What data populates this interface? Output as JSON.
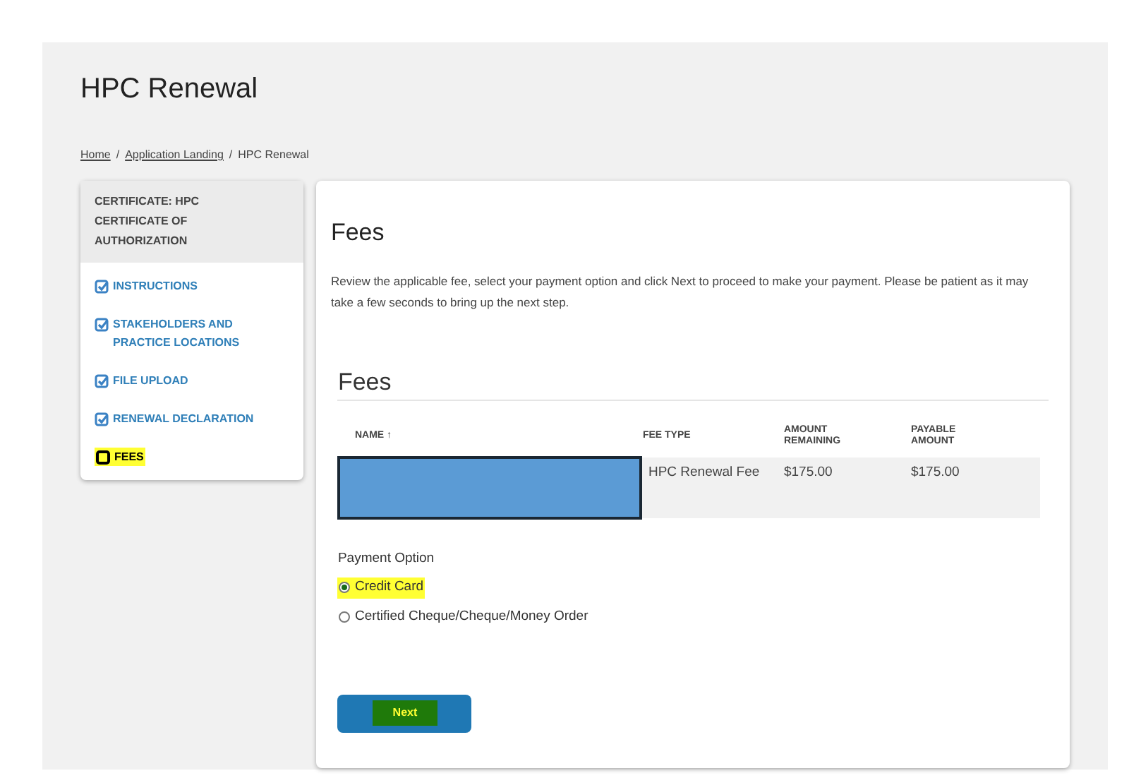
{
  "page_title": "HPC Renewal",
  "breadcrumb": [
    {
      "label": "Home",
      "link": true
    },
    {
      "label": "Application Landing",
      "link": true
    },
    {
      "label": "HPC Renewal",
      "link": false
    }
  ],
  "breadcrumb_separator": "/",
  "sidebar": {
    "header": "CERTIFICATE: HPC CERTIFICATE OF AUTHORIZATION",
    "items": [
      {
        "label": "INSTRUCTIONS",
        "completed": true,
        "highlighted": false
      },
      {
        "label": "STAKEHOLDERS AND PRACTICE LOCATIONS",
        "completed": true,
        "highlighted": false
      },
      {
        "label": "FILE UPLOAD",
        "completed": true,
        "highlighted": false
      },
      {
        "label": "RENEWAL DECLARATION",
        "completed": true,
        "highlighted": false
      },
      {
        "label": "FEES",
        "completed": false,
        "highlighted": true
      }
    ]
  },
  "main": {
    "title": "Fees",
    "description": "Review the applicable fee, select your payment option and click Next to proceed to make your payment. Please be patient as it may take a few seconds to bring up the next step.",
    "section_title": "Fees",
    "table": {
      "sort_indicator": "↑",
      "columns": [
        {
          "label": "NAME",
          "sorted": true
        },
        {
          "label": "FEE TYPE",
          "sorted": false
        },
        {
          "label": "AMOUNT REMAINING",
          "sorted": false
        },
        {
          "label": "PAYABLE AMOUNT",
          "sorted": false
        }
      ],
      "rows": [
        {
          "name_redacted": true,
          "fee_type": "HPC Renewal Fee",
          "amount_remaining": "$175.00",
          "payable_amount": "$175.00"
        }
      ]
    },
    "payment_option": {
      "label": "Payment Option",
      "options": [
        {
          "label": "Credit Card",
          "selected": true,
          "highlighted": true
        },
        {
          "label": "Certified Cheque/Cheque/Money Order",
          "selected": false,
          "highlighted": false
        }
      ]
    },
    "next_button": {
      "label": "Next",
      "highlighted": true
    }
  }
}
